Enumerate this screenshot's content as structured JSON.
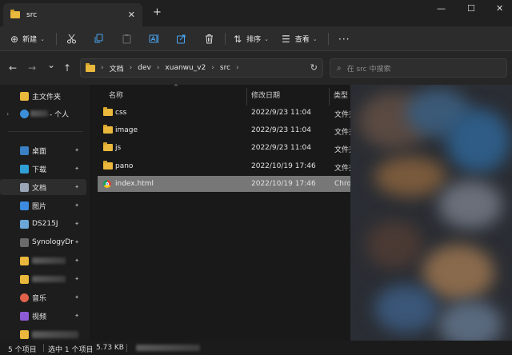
{
  "window": {
    "tab_title": "src",
    "tab_close": "✕",
    "new_tab": "+",
    "minimize": "—",
    "maximize": "☐",
    "close": "✕"
  },
  "toolbar": {
    "new_label": "新建",
    "sort_label": "排序",
    "view_label": "查看",
    "more_label": "···",
    "icons": [
      "cut-icon",
      "copy-icon",
      "paste-icon",
      "rename-icon",
      "share-icon",
      "delete-icon"
    ]
  },
  "nav": {
    "back": "←",
    "forward": "→",
    "recent": "⌄",
    "up": "↑"
  },
  "address": {
    "crumbs": [
      "文档",
      "dev",
      "xuanwu_v2",
      "src"
    ],
    "separator": "›",
    "refresh": "↻"
  },
  "search": {
    "placeholder": "在 src 中搜索",
    "icon": "⌕"
  },
  "sidebar": {
    "items": [
      {
        "label": "主文件夹",
        "color": "#e9b83c"
      },
      {
        "label": "- 个人",
        "color": "#3a8fd8"
      },
      {
        "label": "桌面",
        "color": "#3b7fc4"
      },
      {
        "label": "下载",
        "color": "#2f9fd6"
      },
      {
        "label": "文档",
        "color": "#9aa6b8"
      },
      {
        "label": "图片",
        "color": "#3c8be0"
      },
      {
        "label": "DS215J",
        "color": "#6aa7d8"
      },
      {
        "label": "SynologyDr",
        "color": "#6b6b6b"
      },
      {
        "label": "",
        "color": "#e9b83c"
      },
      {
        "label": "",
        "color": "#e9b83c"
      },
      {
        "label": "音乐",
        "color": "#e0624a"
      },
      {
        "label": "视频",
        "color": "#8d5bd6"
      },
      {
        "label": "",
        "color": "#e9b83c"
      }
    ],
    "pin_glyph": "📌"
  },
  "columns": {
    "name": "名称",
    "date": "修改日期",
    "type": "类型",
    "sort_arrow": "^"
  },
  "files": [
    {
      "name": "css",
      "date": "2022/9/23 11:04",
      "type": "文件夹",
      "kind": "folder"
    },
    {
      "name": "image",
      "date": "2022/9/23 11:04",
      "type": "文件夹",
      "kind": "folder"
    },
    {
      "name": "js",
      "date": "2022/9/23 11:04",
      "type": "文件夹",
      "kind": "folder"
    },
    {
      "name": "pano",
      "date": "2022/10/19 17:46",
      "type": "文件夹",
      "kind": "folder"
    },
    {
      "name": "index.html",
      "date": "2022/10/19 17:46",
      "type": "Chrome",
      "kind": "chrome",
      "selected": true
    }
  ],
  "status": {
    "count": "5 个项目",
    "selection": "选中 1 个项目",
    "size": "5.73 KB"
  }
}
